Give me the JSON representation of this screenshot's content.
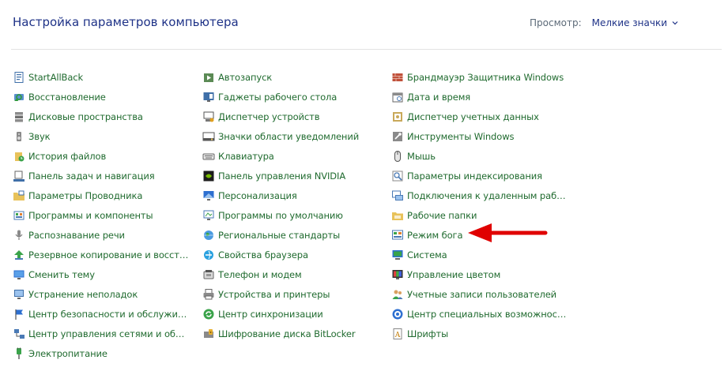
{
  "header": {
    "title": "Настройка параметров компьютера",
    "view_label": "Просмотр:",
    "view_value": "Мелкие значки"
  },
  "colors": {
    "title": "#1e3287",
    "link": "#1f6a2e",
    "arrow": "#e00000"
  },
  "columns": [
    [
      {
        "label": "StartAllBack",
        "icon": "startallback-icon"
      },
      {
        "label": "Восстановление",
        "icon": "recovery-icon"
      },
      {
        "label": "Дисковые пространства",
        "icon": "storage-spaces-icon"
      },
      {
        "label": "Звук",
        "icon": "speaker-icon"
      },
      {
        "label": "История файлов",
        "icon": "file-history-icon"
      },
      {
        "label": "Панель задач и навигация",
        "icon": "taskbar-icon"
      },
      {
        "label": "Параметры Проводника",
        "icon": "folder-options-icon"
      },
      {
        "label": "Программы и компоненты",
        "icon": "programs-icon"
      },
      {
        "label": "Распознавание речи",
        "icon": "microphone-icon"
      },
      {
        "label": "Резервное копирование и восстан...",
        "icon": "backup-icon"
      },
      {
        "label": "Сменить тему",
        "icon": "theme-icon"
      },
      {
        "label": "Устранение неполадок",
        "icon": "troubleshoot-icon"
      },
      {
        "label": "Центр безопасности и обслуживания...",
        "icon": "flag-icon"
      },
      {
        "label": "Центр управления сетями и общи...",
        "icon": "network-icon"
      },
      {
        "label": "Электропитание",
        "icon": "power-icon"
      }
    ],
    [
      {
        "label": "Автозапуск",
        "icon": "autoplay-icon"
      },
      {
        "label": "Гаджеты рабочего стола",
        "icon": "gadgets-icon"
      },
      {
        "label": "Диспетчер устройств",
        "icon": "device-manager-icon"
      },
      {
        "label": "Значки области уведомлений",
        "icon": "notification-icons-icon"
      },
      {
        "label": "Клавиатура",
        "icon": "keyboard-icon"
      },
      {
        "label": "Панель управления NVIDIA",
        "icon": "nvidia-icon"
      },
      {
        "label": "Персонализация",
        "icon": "personalization-icon"
      },
      {
        "label": "Программы по умолчанию",
        "icon": "default-programs-icon"
      },
      {
        "label": "Региональные стандарты",
        "icon": "globe-icon"
      },
      {
        "label": "Свойства браузера",
        "icon": "browser-icon"
      },
      {
        "label": "Телефон и модем",
        "icon": "phone-modem-icon"
      },
      {
        "label": "Устройства и принтеры",
        "icon": "printer-icon"
      },
      {
        "label": "Центр синхронизации",
        "icon": "sync-icon"
      },
      {
        "label": "Шифрование диска BitLocker",
        "icon": "bitlocker-icon"
      }
    ],
    [
      {
        "label": "Брандмауэр Защитника Windows",
        "icon": "firewall-icon"
      },
      {
        "label": "Дата и время",
        "icon": "calendar-icon"
      },
      {
        "label": "Диспетчер учетных данных",
        "icon": "credential-icon"
      },
      {
        "label": "Инструменты Windows",
        "icon": "tools-icon"
      },
      {
        "label": "Мышь",
        "icon": "mouse-icon"
      },
      {
        "label": "Параметры индексирования",
        "icon": "indexing-icon"
      },
      {
        "label": "Подключения к удаленным рабоч...",
        "icon": "remote-desktop-icon"
      },
      {
        "label": "Рабочие папки",
        "icon": "work-folders-icon"
      },
      {
        "label": "Режим бога",
        "icon": "god-mode-icon"
      },
      {
        "label": "Система",
        "icon": "system-icon"
      },
      {
        "label": "Управление цветом",
        "icon": "color-management-icon"
      },
      {
        "label": "Учетные записи пользователей",
        "icon": "users-icon"
      },
      {
        "label": "Центр специальных возможностей",
        "icon": "accessibility-icon"
      },
      {
        "label": "Шрифты",
        "icon": "fonts-icon"
      }
    ]
  ]
}
